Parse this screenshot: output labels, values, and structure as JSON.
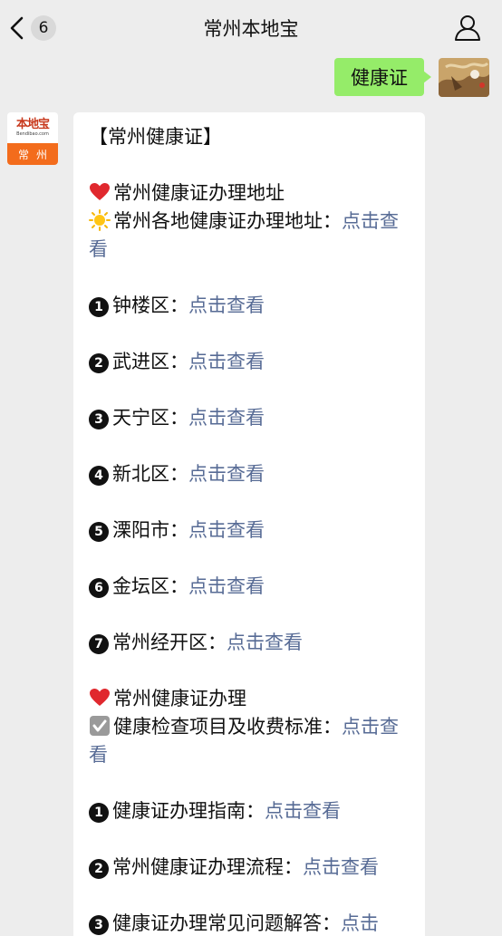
{
  "header": {
    "back_count": "6",
    "title": "常州本地宝"
  },
  "sent": {
    "text": "健康证"
  },
  "bot_avatar": {
    "logo": "本地宝",
    "url": "Bendibao.com",
    "city": "常州"
  },
  "message": {
    "title": "【常州健康证】",
    "section1_heading": "常州健康证办理地址",
    "section1_intro": "常州各地健康证办理地址：",
    "intro_link": "点击查看",
    "districts": [
      {
        "num": "1",
        "label": "钟楼区：",
        "link": "点击查看"
      },
      {
        "num": "2",
        "label": "武进区：",
        "link": "点击查看"
      },
      {
        "num": "3",
        "label": "天宁区：",
        "link": "点击查看"
      },
      {
        "num": "4",
        "label": "新北区：",
        "link": "点击查看"
      },
      {
        "num": "5",
        "label": "溧阳市：",
        "link": "点击查看"
      },
      {
        "num": "6",
        "label": "金坛区：",
        "link": "点击查看"
      },
      {
        "num": "7",
        "label": "常州经开区：",
        "link": "点击查看"
      }
    ],
    "section2_heading": "常州健康证办理",
    "section2_intro": "健康检查项目及收费标准：",
    "section2_link": "点击查看",
    "guides": [
      {
        "num": "1",
        "label": "健康证办理指南：",
        "link": "点击查看"
      },
      {
        "num": "2",
        "label": "常州健康证办理流程：",
        "link": "点击查看"
      },
      {
        "num": "3",
        "label": "健康证办理常见问题解答：",
        "link": "点击"
      }
    ]
  },
  "colors": {
    "link": "#576b95",
    "bubble_green": "#95ec69",
    "background": "#ededed"
  },
  "icons": [
    "back-chevron-icon",
    "user-icon",
    "heart-icon",
    "sun-icon",
    "check-box-icon"
  ]
}
